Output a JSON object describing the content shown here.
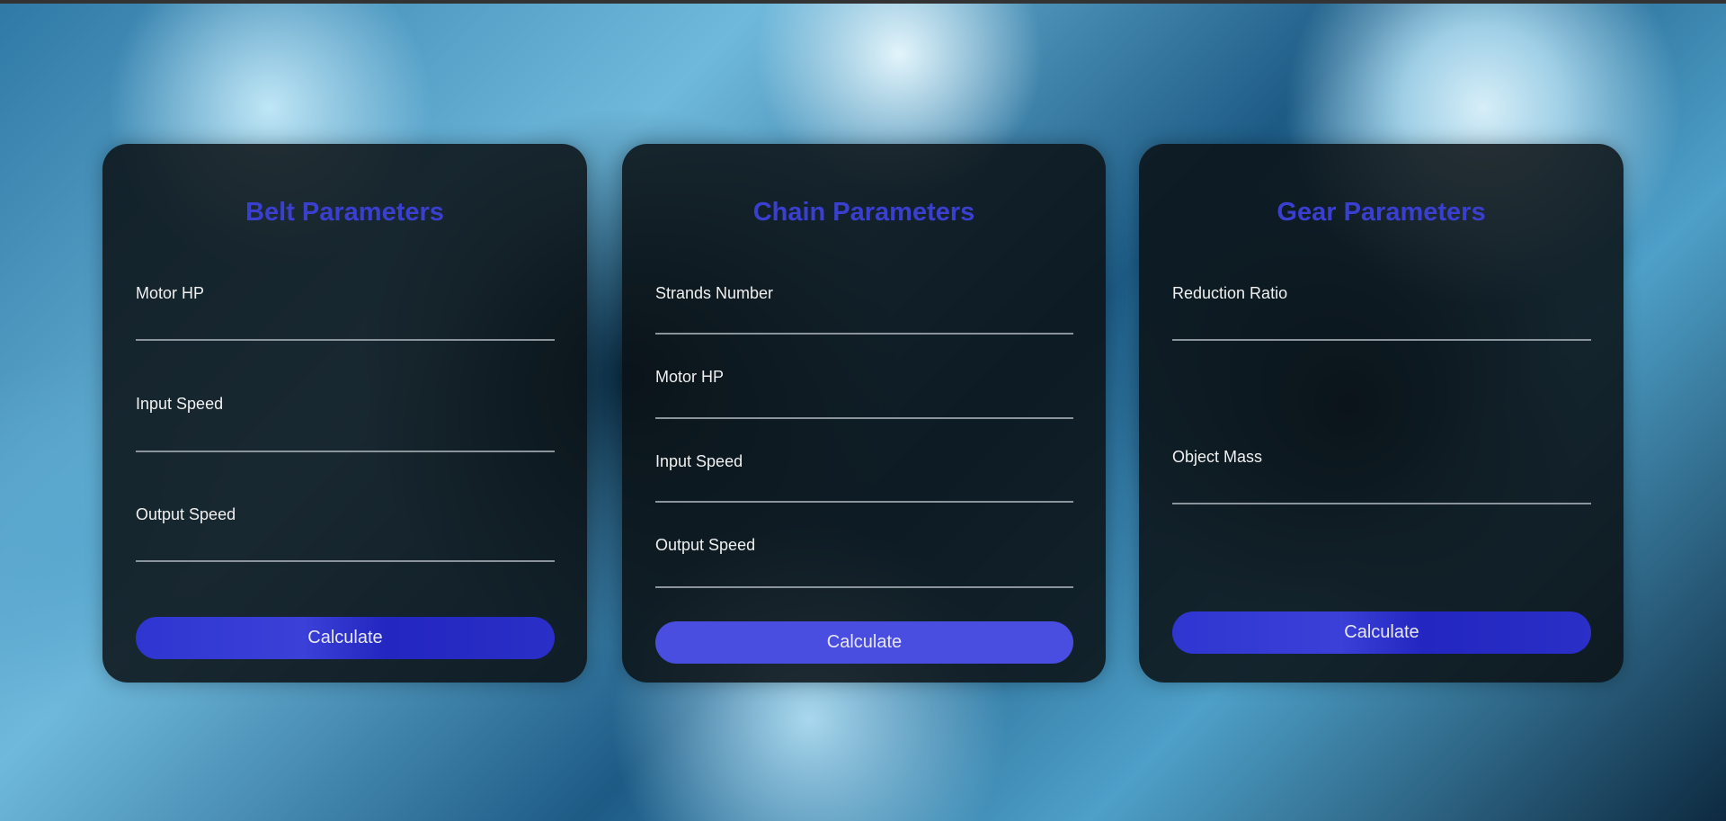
{
  "belt": {
    "title": "Belt Parameters",
    "fields": [
      "Motor HP",
      "Input Speed",
      "Output Speed"
    ],
    "button": "Calculate"
  },
  "chain": {
    "title": "Chain Parameters",
    "fields": [
      "Strands Number",
      "Motor HP",
      "Input Speed",
      "Output Speed"
    ],
    "button": "Calculate"
  },
  "gear": {
    "title": "Gear Parameters",
    "fields": [
      "Reduction Ratio",
      "Object Mass"
    ],
    "button": "Calculate"
  },
  "colors": {
    "accent": "#3a3fd0",
    "button": "#2f35d0"
  }
}
